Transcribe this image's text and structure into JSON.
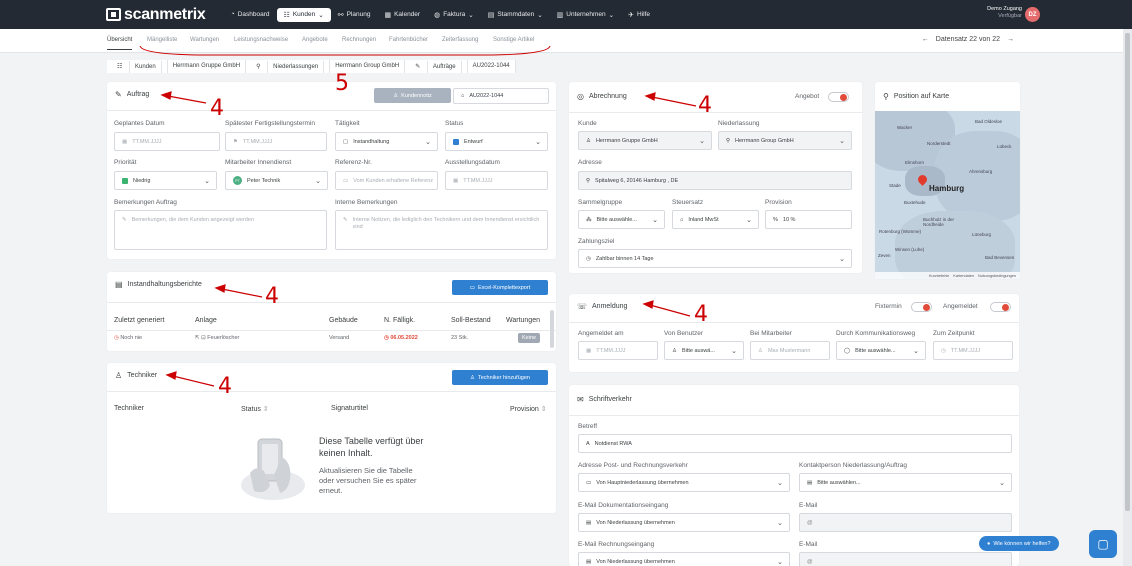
{
  "logo": "scanmetrix",
  "nav": [
    "Dashboard",
    "Kunden",
    "Planung",
    "Kalender",
    "Faktura",
    "Stammdaten",
    "Unternehmen",
    "Hilfe"
  ],
  "user": {
    "name": "Demo Zugang",
    "role": "Verfügbar",
    "initials": "DZ"
  },
  "subtabs": [
    "Übersicht",
    "Mängelliste",
    "Wartungen",
    "Leistungsnachweise",
    "Angebote",
    "Rechnungen",
    "Fahrtenbücher",
    "Zeiterfassung",
    "Sonstige Artikel"
  ],
  "datensatz": "Datensatz 22 von 22",
  "breadcrumb": [
    "Kunden",
    "Herrmann Gruppe GmbH",
    "Niederlassungen",
    "Herrmann Group GmbH",
    "Aufträge",
    "AU2022-1044"
  ],
  "auftrag": {
    "title": "Auftrag",
    "kundennotiz": "Kundennotiz",
    "nummer": "AU2022-1044",
    "lbl_geplant": "Geplantes Datum",
    "ph_geplant": "TT.MM.JJJJ",
    "lbl_spaet": "Spätester Fertigstellungstermin",
    "ph_spaet": "TT.MM.JJJJ",
    "lbl_taet": "Tätigkeit",
    "taet": "Instandhaltung",
    "lbl_status": "Status",
    "status": "Entwurf",
    "lbl_prio": "Priorität",
    "prio": "Niedrig",
    "lbl_mitarb": "Mitarbeiter Innendienst",
    "mitarb": "Peter Technik",
    "mitarb_initials": "PT",
    "lbl_ref": "Referenz-Nr.",
    "ph_ref": "Vom Kunden erhaltene Referenz",
    "lbl_ausst": "Ausstellungsdatum",
    "ph_ausst": "TT.MM.JJJJ",
    "lbl_bem": "Bemerkungen Auftrag",
    "ph_bem": "Bemerkungen, die dem Kunden angezeigt werden",
    "lbl_int": "Interne Bemerkungen",
    "ph_int": "Interne Notizen, die lediglich den Technikern und dem Innendienst ersichtlich sind"
  },
  "berichte": {
    "title": "Instandhaltungsberichte",
    "export": "Excel-Komplettexport",
    "cols": [
      "Zuletzt generiert",
      "Anlage",
      "Gebäude",
      "N. Fälligk.",
      "Soll-Bestand",
      "Wartungen"
    ],
    "row": [
      "Noch nie",
      "Feuerlöscher",
      "Versand",
      "06.05.2022",
      "23 Stk.",
      "Keine"
    ]
  },
  "techniker": {
    "title": "Techniker",
    "add": "Techniker hinzufügen",
    "cols": [
      "Techniker",
      "Status",
      "Signaturtitel",
      "Provision"
    ],
    "empty_title": "Diese Tabelle verfügt über keinen Inhalt.",
    "empty_text": "Aktualisieren Sie die Tabelle oder versuchen Sie es später erneut."
  },
  "abrechnung": {
    "title": "Abrechnung",
    "angebot": "Angebot",
    "lbl_kunde": "Kunde",
    "kunde": "Herrmann Gruppe GmbH",
    "lbl_nl": "Niederlassung",
    "nl": "Herrmann Group GmbH",
    "lbl_adr": "Adresse",
    "adr": "Spitalweg 6, 20146 Hamburg , DE",
    "lbl_sg": "Sammelgruppe",
    "sg": "Bitte auswähle...",
    "lbl_st": "Steuersatz",
    "st": "Inland MwSt",
    "lbl_prov": "Provision",
    "prov": "10 %",
    "lbl_zz": "Zahlungsziel",
    "zz": "Zahlbar binnen 14 Tage"
  },
  "karte": {
    "title": "Position auf Karte",
    "city": "Hamburg",
    "footer": [
      "Kurzbefehle",
      "Kartendaten",
      "Nutzungsbedingungen"
    ],
    "places": [
      "Wacker",
      "Norderstedt",
      "Lübeck",
      "Elmshorn",
      "Stade",
      "Buxtehude",
      "Buchholz in der Nordheide",
      "Winsen (Luhe)",
      "Lüneburg",
      "Bad Bevensen",
      "Bad Oldesloe",
      "Ahrensburg",
      "Rotenburg (Wümme)",
      "Zeven"
    ]
  },
  "anmeldung": {
    "title": "Anmeldung",
    "fixtermin": "Fixtermin",
    "angemeldet": "Angemeldet",
    "lbl_am": "Angemeldet am",
    "ph_am": "TT.MM.JJJJ",
    "lbl_vb": "Von Benutzer",
    "vb": "Bitte auswä...",
    "lbl_bm": "Bei Mitarbeiter",
    "ph_bm": "Max Mustermann",
    "lbl_dk": "Durch Kommunikationsweg",
    "dk": "Bitte auswähle...",
    "lbl_zp": "Zum Zeitpunkt",
    "ph_zp": "TT.MM.JJJJ"
  },
  "schrift": {
    "title": "Schriftverkehr",
    "lbl_betreff": "Betreff",
    "betreff": "Notdienst RWA",
    "lbl_adr": "Adresse Post- und Rechnungsverkehr",
    "adr": "Von Hauptniederlassung übernehmen",
    "lbl_kp": "Kontaktperson Niederlassung/Auftrag",
    "kp": "Bitte auswählen...",
    "lbl_emd": "E-Mail Dokumentationseingang",
    "emd": "Von Niederlassung übernehmen",
    "lbl_em1": "E-Mail",
    "em1": "@",
    "lbl_emr": "E-Mail Rechnungseingang",
    "emr": "Von Niederlassung übernehmen",
    "lbl_em2": "E-Mail",
    "em2": "@"
  },
  "annotations": [
    "4",
    "4",
    "4",
    "4",
    "4",
    "5"
  ],
  "chat": "Wie können wir helfen?",
  "colors": {
    "nav": "#242a33",
    "accent": "#2f80d1",
    "annotation": "#cc0000",
    "toggle": "#e24a3a"
  }
}
